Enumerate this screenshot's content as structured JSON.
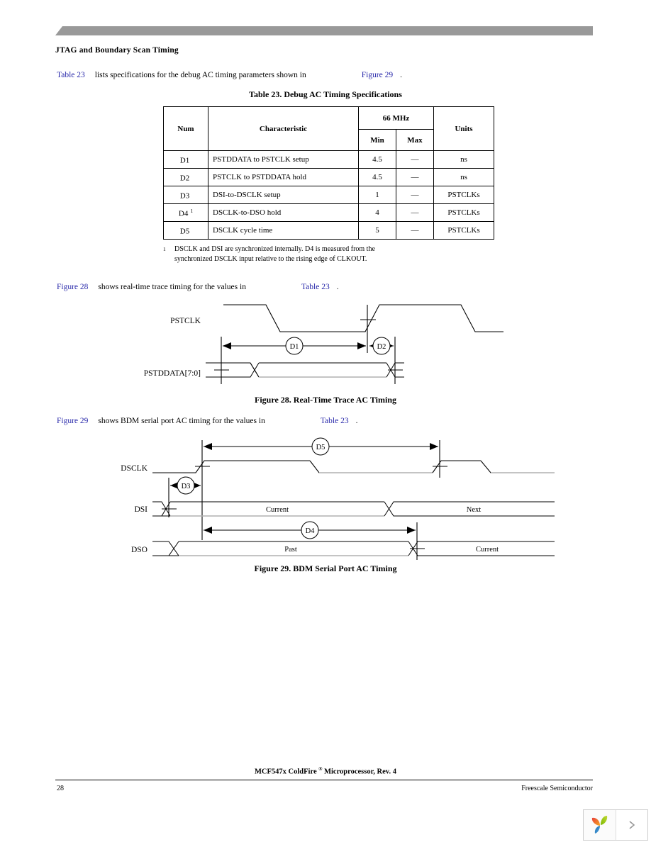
{
  "header": {
    "section_title": "JTAG and Boundary Scan Timing"
  },
  "intro": {
    "link_table": "Table 23",
    "text": "lists specifications for the debug AC timing parameters shown in",
    "link_figure": "Figure 29",
    "period": "."
  },
  "table": {
    "caption": "Table 23. Debug AC Timing Specifications",
    "headers": {
      "num": "Num",
      "characteristic": "Characteristic",
      "freq_group": "66 MHz",
      "min": "Min",
      "max": "Max",
      "units": "Units"
    },
    "rows": [
      {
        "num": "D1",
        "num_sup": "",
        "characteristic": "PSTDDATA to PSTCLK setup",
        "min": "4.5",
        "max": "—",
        "units": "ns"
      },
      {
        "num": "D2",
        "num_sup": "",
        "characteristic": "PSTCLK to PSTDDATA hold",
        "min": "4.5",
        "max": "—",
        "units": "ns"
      },
      {
        "num": "D3",
        "num_sup": "",
        "characteristic": "DSI-to-DSCLK setup",
        "min": "1",
        "max": "—",
        "units": "PSTCLKs"
      },
      {
        "num": "D4",
        "num_sup": "1",
        "characteristic": "DSCLK-to-DSO hold",
        "min": "4",
        "max": "—",
        "units": "PSTCLKs"
      },
      {
        "num": "D5",
        "num_sup": "",
        "characteristic": "DSCLK cycle time",
        "min": "5",
        "max": "—",
        "units": "PSTCLKs"
      }
    ],
    "footnote_marker": "1",
    "footnote_line1": "DSCLK and DSI are synchronized internally. D4 is measured from the",
    "footnote_line2": "synchronized DSCLK input relative to the rising edge of CLKOUT."
  },
  "figure28": {
    "intro_link": "Figure 28",
    "intro_text": "shows real-time trace timing for the values in",
    "intro_link2": "Table 23",
    "intro_period": ".",
    "caption": "Figure 28. Real-Time Trace AC Timing",
    "signals": {
      "clk_label": "PSTCLK",
      "data_label": "PSTDDATA[7:0]"
    },
    "markers": {
      "d1": "D1",
      "d2": "D2"
    }
  },
  "figure29": {
    "intro_link": "Figure 29",
    "intro_text": "shows BDM serial port AC timing for the values in",
    "intro_link2": "Table 23",
    "intro_period": ".",
    "caption": "Figure 29. BDM Serial Port AC Timing",
    "signals": {
      "dsclk_label": "DSCLK",
      "dsi_label": "DSI",
      "dso_label": "DSO"
    },
    "markers": {
      "d3": "D3",
      "d4": "D4",
      "d5": "D5"
    },
    "bus_values": {
      "dsi_first": "Current",
      "dsi_second": "Next",
      "dso_first": "Past",
      "dso_second": "Current"
    }
  },
  "footer": {
    "center_part1": "MCF547x ColdFire",
    "center_reg": "®",
    "center_part2": "Microprocessor, Rev. 4",
    "page_number": "28",
    "company": "Freescale Semiconductor"
  },
  "viewer": {
    "logo_name": "sprout-logo",
    "next_label": "›"
  },
  "colors": {
    "link": "#2828aa",
    "header_bar": "#999999",
    "shadow": "#b0b0b0"
  }
}
